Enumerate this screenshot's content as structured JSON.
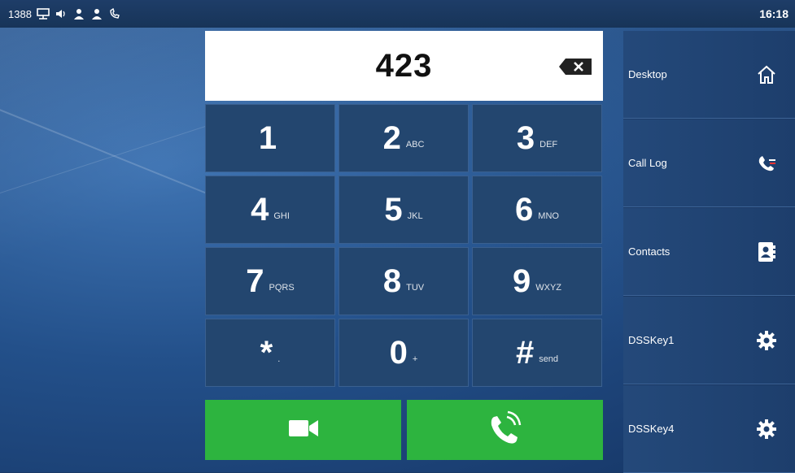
{
  "status": {
    "account": "1388",
    "icons": [
      "network-icon",
      "volume-icon",
      "contact-icon",
      "user-icon",
      "call-forward-icon"
    ],
    "time": "16:18"
  },
  "dial": {
    "number": "423"
  },
  "keypad": [
    {
      "digit": "1",
      "sub": ""
    },
    {
      "digit": "2",
      "sub": "ABC"
    },
    {
      "digit": "3",
      "sub": "DEF"
    },
    {
      "digit": "4",
      "sub": "GHI"
    },
    {
      "digit": "5",
      "sub": "JKL"
    },
    {
      "digit": "6",
      "sub": "MNO"
    },
    {
      "digit": "7",
      "sub": "PQRS"
    },
    {
      "digit": "8",
      "sub": "TUV"
    },
    {
      "digit": "9",
      "sub": "WXYZ"
    },
    {
      "digit": "*",
      "sub": "."
    },
    {
      "digit": "0",
      "sub": "+"
    },
    {
      "digit": "#",
      "sub": "send"
    }
  ],
  "side_menu": [
    {
      "label": "Desktop",
      "icon": "home-icon"
    },
    {
      "label": "Call Log",
      "icon": "call-log-icon"
    },
    {
      "label": "Contacts",
      "icon": "contacts-icon"
    },
    {
      "label": "DSSKey1",
      "icon": "gear-icon"
    },
    {
      "label": "DSSKey4",
      "icon": "gear-icon"
    }
  ],
  "colors": {
    "call_green": "#2db43f",
    "key_bg": "#23466f",
    "display_bg": "#ffffff"
  }
}
